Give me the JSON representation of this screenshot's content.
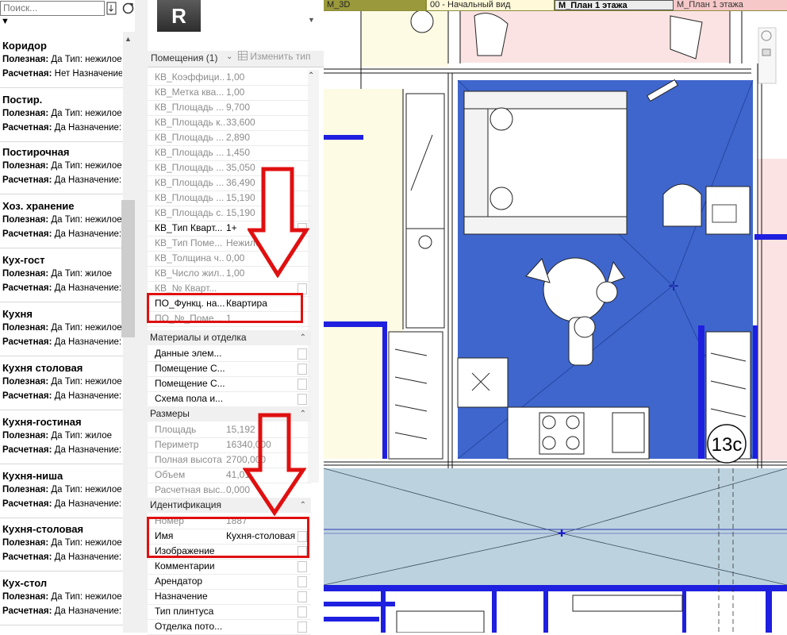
{
  "browser": {
    "search_placeholder": "Поиск...",
    "collapse_glyph": "▼",
    "items": [
      {
        "title": "Коридор",
        "line1_k": "Полезная:",
        "line1_v": "Да Тип: нежилое",
        "line2_k": "Расчетная:",
        "line2_v": "Нет Назначение:"
      },
      {
        "title": "Постир.",
        "line1_k": "Полезная:",
        "line1_v": "Да Тип: нежилое",
        "line2_k": "Расчетная:",
        "line2_v": "Да Назначение:"
      },
      {
        "title": "Постирочная",
        "line1_k": "Полезная:",
        "line1_v": "Да Тип: нежилое",
        "line2_k": "Расчетная:",
        "line2_v": "Да Назначение:"
      },
      {
        "title": "Хоз. хранение",
        "line1_k": "Полезная:",
        "line1_v": "Да Тип: нежилое",
        "line2_k": "Расчетная:",
        "line2_v": "Да Назначение:"
      },
      {
        "title": "Кух-гост",
        "line1_k": "Полезная:",
        "line1_v": "Да Тип: жилое",
        "line2_k": "Расчетная:",
        "line2_v": "Да Назначение:"
      },
      {
        "title": "Кухня",
        "line1_k": "Полезная:",
        "line1_v": "Да Тип: нежилое",
        "line2_k": "Расчетная:",
        "line2_v": "Да Назначение:"
      },
      {
        "title": "Кухня столовая",
        "line1_k": "Полезная:",
        "line1_v": "Да Тип: нежилое",
        "line2_k": "Расчетная:",
        "line2_v": "Да Назначение:"
      },
      {
        "title": "Кухня-гостиная",
        "line1_k": "Полезная:",
        "line1_v": "Да Тип: жилое",
        "line2_k": "Расчетная:",
        "line2_v": "Да Назначение:"
      },
      {
        "title": "Кухня-ниша",
        "line1_k": "Полезная:",
        "line1_v": "Да Тип: нежилое",
        "line2_k": "Расчетная:",
        "line2_v": "Да Назначение:"
      },
      {
        "title": "Кухня-столовая",
        "line1_k": "Полезная:",
        "line1_v": "Да Тип: нежилое",
        "line2_k": "Расчетная:",
        "line2_v": "Да Назначение:"
      },
      {
        "title": "Кух-стол",
        "line1_k": "Полезная:",
        "line1_v": "Да Тип: нежилое",
        "line2_k": "Расчетная:",
        "line2_v": "Да Назначение:"
      }
    ]
  },
  "properties": {
    "logo_letter": "R",
    "selection": "Помещения (1)",
    "edit_type": "Изменить тип",
    "rows": [
      {
        "name": "КВ_Коэффици...",
        "value": "1,00",
        "grey": true
      },
      {
        "name": "КВ_Метка ква...",
        "value": "1,00",
        "grey": true
      },
      {
        "name": "КВ_Площадь ...",
        "value": "9,700",
        "grey": true
      },
      {
        "name": "КВ_Площадь к...",
        "value": "33,600",
        "grey": true
      },
      {
        "name": "КВ_Площадь ...",
        "value": "2,890",
        "grey": true
      },
      {
        "name": "КВ_Площадь ...",
        "value": "1,450",
        "grey": true
      },
      {
        "name": "КВ_Площадь ...",
        "value": "35,050",
        "grey": true
      },
      {
        "name": "КВ_Площадь ...",
        "value": "36,490",
        "grey": true
      },
      {
        "name": "КВ_Площадь ...",
        "value": "15,190",
        "grey": true
      },
      {
        "name": "КВ_Площадь с...",
        "value": "15,190",
        "grey": true
      },
      {
        "name": "КВ_Тип Кварт...",
        "value": "1+",
        "grey": false
      },
      {
        "name": "КВ_Тип Поме...",
        "value": "Нежилое",
        "grey": true
      },
      {
        "name": "КВ_Толщина ч...",
        "value": "0,00",
        "grey": true
      },
      {
        "name": "КВ_Число жил...",
        "value": "1,00",
        "grey": true
      },
      {
        "name": "КВ_№ Кварт...",
        "value": "",
        "grey": true
      },
      {
        "name": "ПО_Функц. на...",
        "value": "Квартира",
        "grey": false
      },
      {
        "name": "ПО_№_Поме...",
        "value": "1",
        "grey": true
      }
    ],
    "cat_materials": "Материалы и отделка",
    "materials_rows": [
      {
        "name": "Данные элем...",
        "value": ""
      },
      {
        "name": "Помещение С...",
        "value": ""
      },
      {
        "name": "Помещение С...",
        "value": ""
      },
      {
        "name": "Схема пола и...",
        "value": ""
      }
    ],
    "cat_dimensions": "Размеры",
    "dimension_rows": [
      {
        "name": "Площадь",
        "value": "15,192"
      },
      {
        "name": "Периметр",
        "value": "16340,000"
      },
      {
        "name": "Полная высота",
        "value": "2700,000"
      },
      {
        "name": "Объем",
        "value": "41,01"
      },
      {
        "name": "Расчетная выс...",
        "value": "0,000"
      }
    ],
    "cat_identity": "Идентификация",
    "identity_rows": [
      {
        "name": "Номер",
        "value": "1887",
        "grey": true
      },
      {
        "name": "Имя",
        "value": "Кухня-столовая",
        "grey": false
      },
      {
        "name": "Изображение",
        "value": "",
        "grey": false
      },
      {
        "name": "Комментарии",
        "value": "",
        "grey": false
      },
      {
        "name": "Арендатор",
        "value": "",
        "grey": false
      },
      {
        "name": "Назначение",
        "value": "",
        "grey": false
      },
      {
        "name": "Тип плинтуса",
        "value": "",
        "grey": false
      },
      {
        "name": "Отделка пото...",
        "value": "",
        "grey": false
      }
    ]
  },
  "view_tabs": [
    {
      "label": "M_3D"
    },
    {
      "label": "00 - Начальный вид"
    },
    {
      "label": "M_План 1 этажа"
    },
    {
      "label": "M_План 1 этажа"
    }
  ],
  "plan": {
    "room_tag": "13с"
  },
  "colors": {
    "selected_room": "#3f66cc",
    "wall": "#1f1fe0",
    "annotation": "#e01010",
    "corridor": "#bcd2df",
    "pink_room": "#fbe3e3",
    "yellow_room": "#fdfbe3"
  }
}
